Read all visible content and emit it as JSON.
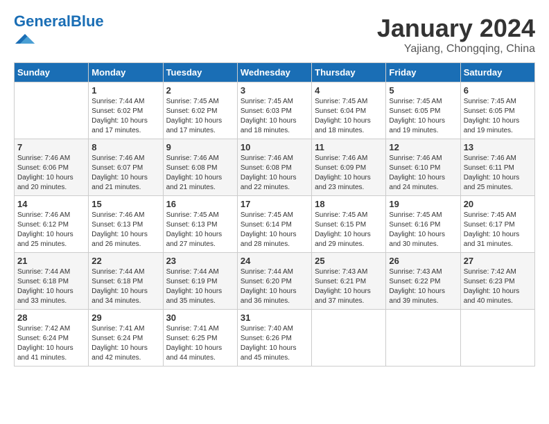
{
  "header": {
    "logo_general": "General",
    "logo_blue": "Blue",
    "title": "January 2024",
    "subtitle": "Yajiang, Chongqing, China"
  },
  "calendar": {
    "headers": [
      "Sunday",
      "Monday",
      "Tuesday",
      "Wednesday",
      "Thursday",
      "Friday",
      "Saturday"
    ],
    "weeks": [
      [
        {
          "day": "",
          "sunrise": "",
          "sunset": "",
          "daylight": ""
        },
        {
          "day": "1",
          "sunrise": "Sunrise: 7:44 AM",
          "sunset": "Sunset: 6:02 PM",
          "daylight": "Daylight: 10 hours and 17 minutes."
        },
        {
          "day": "2",
          "sunrise": "Sunrise: 7:45 AM",
          "sunset": "Sunset: 6:02 PM",
          "daylight": "Daylight: 10 hours and 17 minutes."
        },
        {
          "day": "3",
          "sunrise": "Sunrise: 7:45 AM",
          "sunset": "Sunset: 6:03 PM",
          "daylight": "Daylight: 10 hours and 18 minutes."
        },
        {
          "day": "4",
          "sunrise": "Sunrise: 7:45 AM",
          "sunset": "Sunset: 6:04 PM",
          "daylight": "Daylight: 10 hours and 18 minutes."
        },
        {
          "day": "5",
          "sunrise": "Sunrise: 7:45 AM",
          "sunset": "Sunset: 6:05 PM",
          "daylight": "Daylight: 10 hours and 19 minutes."
        },
        {
          "day": "6",
          "sunrise": "Sunrise: 7:45 AM",
          "sunset": "Sunset: 6:05 PM",
          "daylight": "Daylight: 10 hours and 19 minutes."
        }
      ],
      [
        {
          "day": "7",
          "sunrise": "Sunrise: 7:46 AM",
          "sunset": "Sunset: 6:06 PM",
          "daylight": "Daylight: 10 hours and 20 minutes."
        },
        {
          "day": "8",
          "sunrise": "Sunrise: 7:46 AM",
          "sunset": "Sunset: 6:07 PM",
          "daylight": "Daylight: 10 hours and 21 minutes."
        },
        {
          "day": "9",
          "sunrise": "Sunrise: 7:46 AM",
          "sunset": "Sunset: 6:08 PM",
          "daylight": "Daylight: 10 hours and 21 minutes."
        },
        {
          "day": "10",
          "sunrise": "Sunrise: 7:46 AM",
          "sunset": "Sunset: 6:08 PM",
          "daylight": "Daylight: 10 hours and 22 minutes."
        },
        {
          "day": "11",
          "sunrise": "Sunrise: 7:46 AM",
          "sunset": "Sunset: 6:09 PM",
          "daylight": "Daylight: 10 hours and 23 minutes."
        },
        {
          "day": "12",
          "sunrise": "Sunrise: 7:46 AM",
          "sunset": "Sunset: 6:10 PM",
          "daylight": "Daylight: 10 hours and 24 minutes."
        },
        {
          "day": "13",
          "sunrise": "Sunrise: 7:46 AM",
          "sunset": "Sunset: 6:11 PM",
          "daylight": "Daylight: 10 hours and 25 minutes."
        }
      ],
      [
        {
          "day": "14",
          "sunrise": "Sunrise: 7:46 AM",
          "sunset": "Sunset: 6:12 PM",
          "daylight": "Daylight: 10 hours and 25 minutes."
        },
        {
          "day": "15",
          "sunrise": "Sunrise: 7:46 AM",
          "sunset": "Sunset: 6:13 PM",
          "daylight": "Daylight: 10 hours and 26 minutes."
        },
        {
          "day": "16",
          "sunrise": "Sunrise: 7:45 AM",
          "sunset": "Sunset: 6:13 PM",
          "daylight": "Daylight: 10 hours and 27 minutes."
        },
        {
          "day": "17",
          "sunrise": "Sunrise: 7:45 AM",
          "sunset": "Sunset: 6:14 PM",
          "daylight": "Daylight: 10 hours and 28 minutes."
        },
        {
          "day": "18",
          "sunrise": "Sunrise: 7:45 AM",
          "sunset": "Sunset: 6:15 PM",
          "daylight": "Daylight: 10 hours and 29 minutes."
        },
        {
          "day": "19",
          "sunrise": "Sunrise: 7:45 AM",
          "sunset": "Sunset: 6:16 PM",
          "daylight": "Daylight: 10 hours and 30 minutes."
        },
        {
          "day": "20",
          "sunrise": "Sunrise: 7:45 AM",
          "sunset": "Sunset: 6:17 PM",
          "daylight": "Daylight: 10 hours and 31 minutes."
        }
      ],
      [
        {
          "day": "21",
          "sunrise": "Sunrise: 7:44 AM",
          "sunset": "Sunset: 6:18 PM",
          "daylight": "Daylight: 10 hours and 33 minutes."
        },
        {
          "day": "22",
          "sunrise": "Sunrise: 7:44 AM",
          "sunset": "Sunset: 6:18 PM",
          "daylight": "Daylight: 10 hours and 34 minutes."
        },
        {
          "day": "23",
          "sunrise": "Sunrise: 7:44 AM",
          "sunset": "Sunset: 6:19 PM",
          "daylight": "Daylight: 10 hours and 35 minutes."
        },
        {
          "day": "24",
          "sunrise": "Sunrise: 7:44 AM",
          "sunset": "Sunset: 6:20 PM",
          "daylight": "Daylight: 10 hours and 36 minutes."
        },
        {
          "day": "25",
          "sunrise": "Sunrise: 7:43 AM",
          "sunset": "Sunset: 6:21 PM",
          "daylight": "Daylight: 10 hours and 37 minutes."
        },
        {
          "day": "26",
          "sunrise": "Sunrise: 7:43 AM",
          "sunset": "Sunset: 6:22 PM",
          "daylight": "Daylight: 10 hours and 39 minutes."
        },
        {
          "day": "27",
          "sunrise": "Sunrise: 7:42 AM",
          "sunset": "Sunset: 6:23 PM",
          "daylight": "Daylight: 10 hours and 40 minutes."
        }
      ],
      [
        {
          "day": "28",
          "sunrise": "Sunrise: 7:42 AM",
          "sunset": "Sunset: 6:24 PM",
          "daylight": "Daylight: 10 hours and 41 minutes."
        },
        {
          "day": "29",
          "sunrise": "Sunrise: 7:41 AM",
          "sunset": "Sunset: 6:24 PM",
          "daylight": "Daylight: 10 hours and 42 minutes."
        },
        {
          "day": "30",
          "sunrise": "Sunrise: 7:41 AM",
          "sunset": "Sunset: 6:25 PM",
          "daylight": "Daylight: 10 hours and 44 minutes."
        },
        {
          "day": "31",
          "sunrise": "Sunrise: 7:40 AM",
          "sunset": "Sunset: 6:26 PM",
          "daylight": "Daylight: 10 hours and 45 minutes."
        },
        {
          "day": "",
          "sunrise": "",
          "sunset": "",
          "daylight": ""
        },
        {
          "day": "",
          "sunrise": "",
          "sunset": "",
          "daylight": ""
        },
        {
          "day": "",
          "sunrise": "",
          "sunset": "",
          "daylight": ""
        }
      ]
    ]
  }
}
